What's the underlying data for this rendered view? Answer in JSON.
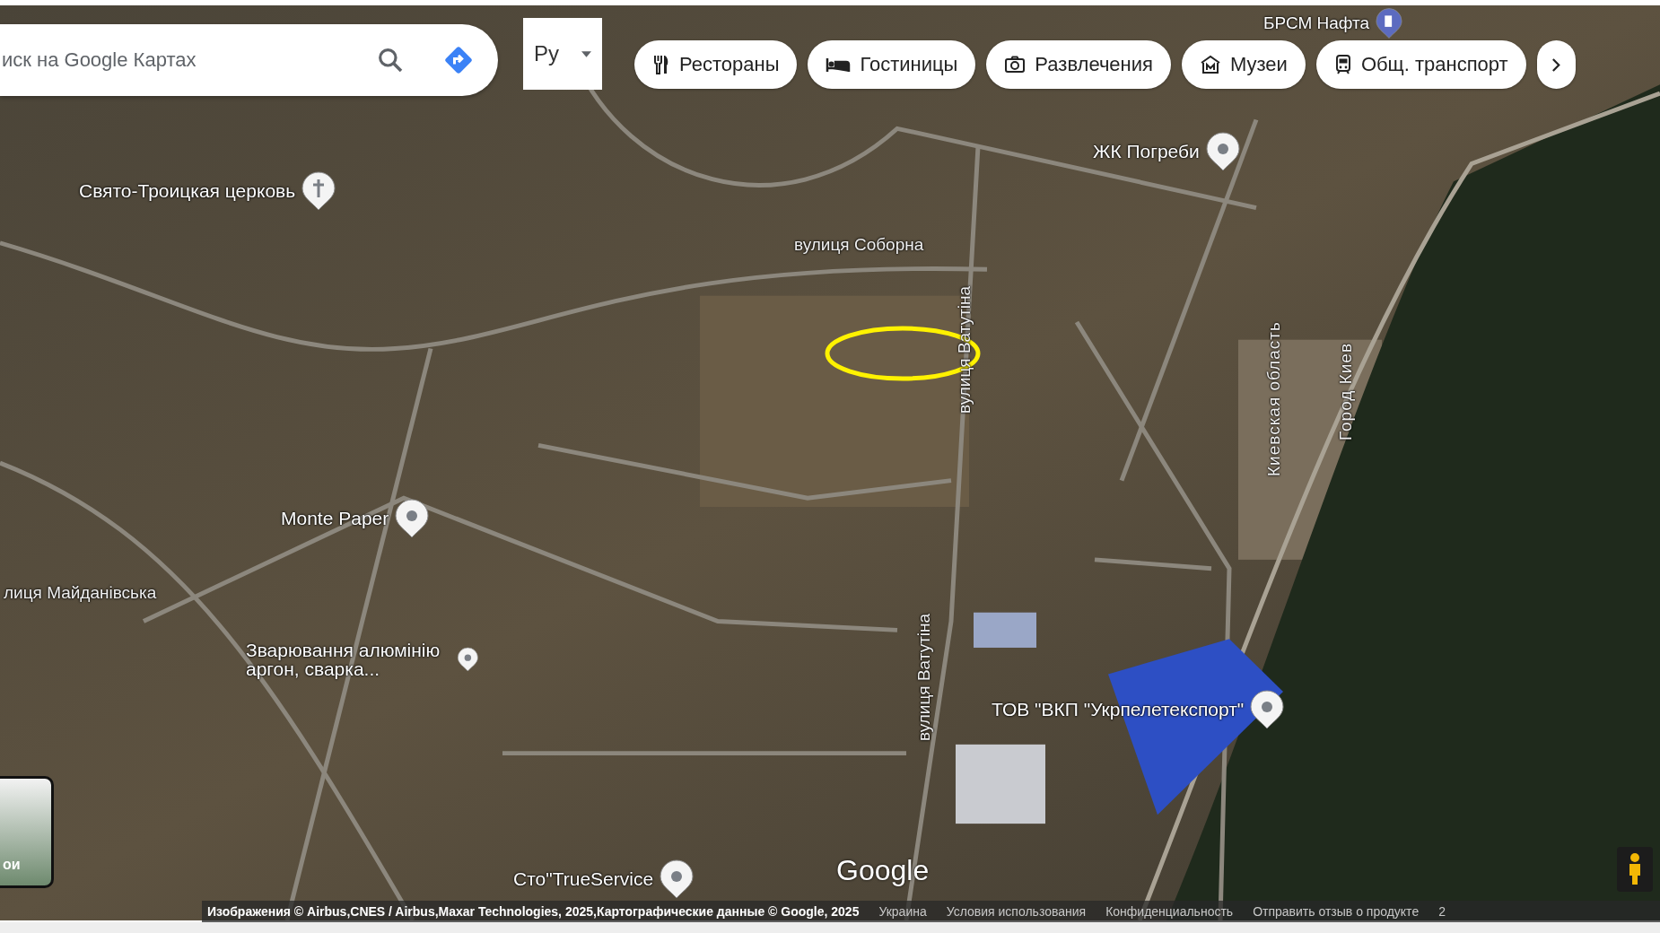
{
  "search": {
    "placeholder": "иск на Google Картах"
  },
  "language": {
    "label": "Ру"
  },
  "chips": [
    {
      "kind": "restaurant",
      "label": "Рестораны"
    },
    {
      "kind": "hotel",
      "label": "Гостиницы"
    },
    {
      "kind": "camera",
      "label": "Развлечения"
    },
    {
      "kind": "museum",
      "label": "Музеи"
    },
    {
      "kind": "transit",
      "label": "Общ. транспорт"
    }
  ],
  "map_labels": [
    {
      "kind": "fuel",
      "text": "БРСМ Нафта"
    },
    {
      "kind": "place",
      "text": "ЖК Погреби"
    },
    {
      "kind": "church",
      "text": "Свято-Троицкая церковь"
    },
    {
      "kind": "street",
      "text": "вулиця Соборна"
    },
    {
      "kind": "street",
      "text": "вулиця Ватутіна"
    },
    {
      "kind": "place",
      "text": "Monte Paper"
    },
    {
      "kind": "street",
      "text": "лиця Майданівська"
    },
    {
      "kind": "place",
      "text": "Зварювання алюмінію аргон, сварка..."
    },
    {
      "kind": "place",
      "text": "ТОВ \"ВКП \"Укрпелетекспорт\""
    },
    {
      "kind": "street",
      "text": "вулиця Ватутіна"
    },
    {
      "kind": "region",
      "text": "Киевская область"
    },
    {
      "kind": "region",
      "text": "Город Киев"
    },
    {
      "kind": "place",
      "text": "Сто\"TrueService"
    }
  ],
  "logo": "Google",
  "layers": {
    "label": "ои"
  },
  "attribution": [
    "Изображения © Airbus,CNES / Airbus,Maxar Technologies, 2025,Картографические данные © Google, 2025",
    "Украина",
    "Условия использования",
    "Конфиденциальность",
    "Отправить отзыв о продукте",
    "2"
  ]
}
